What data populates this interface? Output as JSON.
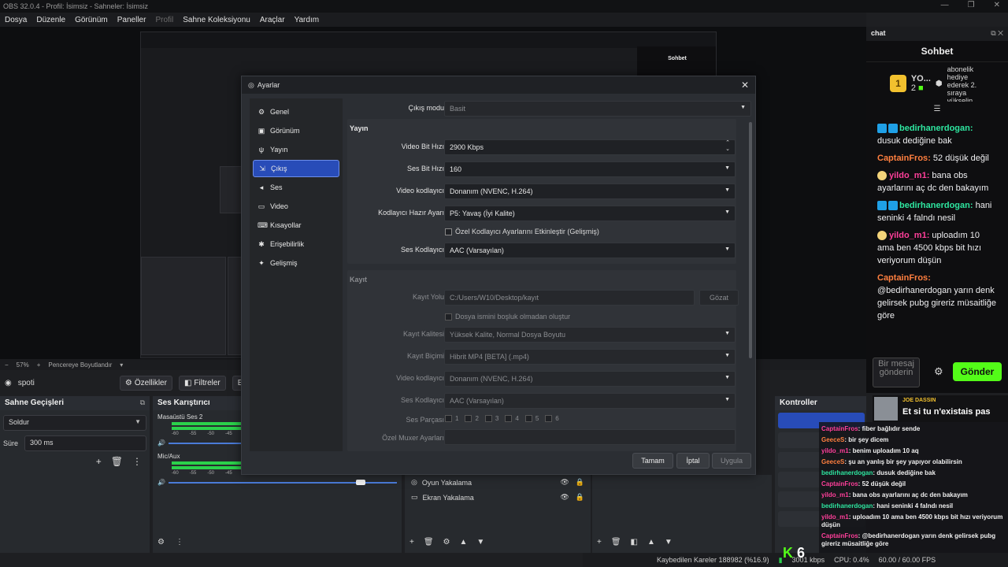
{
  "window": {
    "title": "OBS 32.0.4 - Profil: İsimsiz - Sahneler: İsimsiz"
  },
  "menu": [
    "Dosya",
    "Düzenle",
    "Görünüm",
    "Paneller",
    "Profil",
    "Sahne Koleksiyonu",
    "Araçlar",
    "Yardım"
  ],
  "preview": {
    "zoom": "57%",
    "fit_label": "Pencereye Boyutlandır",
    "mini_chat_title": "Sohbet"
  },
  "source_bar": {
    "source": "spoti",
    "properties": "Özellikler",
    "filters": "Filtreler",
    "more": "Et"
  },
  "scene_transitions": {
    "title": "Sahne Geçişleri",
    "transition": "Soldur",
    "duration_label": "Süre",
    "duration": "300 ms"
  },
  "mixer": {
    "title": "Ses Karıştırıcı",
    "channels": [
      {
        "name": "Masaüstü Ses 2",
        "ticks": [
          "-60",
          "-55",
          "-50",
          "-45"
        ]
      },
      {
        "name": "Mic/Aux",
        "ticks": [
          "-60",
          "-55",
          "-50",
          "-45"
        ]
      }
    ]
  },
  "sources": [
    {
      "name": "Oyun Yakalama"
    },
    {
      "name": "Ekran Yakalama"
    }
  ],
  "controls": {
    "title": "Kontroller"
  },
  "chat": {
    "dock_title": "chat",
    "title": "Sohbet",
    "pinned_user": "YO...",
    "pinned_rank": "1",
    "pinned_count": "2",
    "gift_text": "abonelik hediye ederek 2. sıraya yükselin",
    "messages": [
      {
        "user": "bedirhanerdogan",
        "text": "dusuk dediğine bak",
        "color": "green"
      },
      {
        "user": "CaptainFros",
        "text": "52 düşük değil",
        "color": "orange"
      },
      {
        "user": "yildo_m1",
        "text": "bana obs ayarlarını aç dc den bakayım",
        "color": "pink"
      },
      {
        "user": "bedirhanerdogan",
        "text": "hani seninki 4 falndı nesil",
        "color": "green"
      },
      {
        "user": "yildo_m1",
        "text": "uploadım 10 ama ben 4500 kbps bit hızı veriyorum düşün",
        "color": "pink"
      },
      {
        "user": "CaptainFros",
        "text": "@bedirhanerdogan yarın denk gelirsek pubg gireriz müsaitliğe göre",
        "color": "orange"
      }
    ],
    "input_placeholder": "Bir mesaj gönderin",
    "send": "Gönder"
  },
  "music": {
    "artist": "JOE DASSIN",
    "song": "Et si tu n'existais pas"
  },
  "overlay_chat": [
    {
      "user": "CaptainFros",
      "text": "fiber bağlıdır sende"
    },
    {
      "user": "GeeceS",
      "text": "bir şey dicem"
    },
    {
      "user": "yildo_m1",
      "text": "benim uploadım 10 aq"
    },
    {
      "user": "GeeceS",
      "text": "şu an yanlış bir şey yapıyor olabilirsin"
    },
    {
      "user": "bedirhanerdogan",
      "text": "dusuk dediğine bak"
    },
    {
      "user": "CaptainFros",
      "text": "52 düşük değil"
    },
    {
      "user": "yildo_m1",
      "text": "bana obs ayarlarını aç dc den bakayım"
    },
    {
      "user": "bedirhanerdogan",
      "text": "hani seninki 4 falndı nesil"
    },
    {
      "user": "yildo_m1",
      "text": "uploadım 10 ama ben 4500 kbps bit hızı veriyorum düşün"
    },
    {
      "user": "CaptainFros",
      "text": "@bedirhanerdogan yarın denk gelirsek pubg gireriz müsaitliğe göre"
    }
  ],
  "status": {
    "dropped": "Kaybedilen Kareler 188982 (%16.9)",
    "bitrate": "3001 kbps",
    "cpu": "CPU: 0.4%",
    "fps": "60.00 / 60.00 FPS",
    "kick_count": "6"
  },
  "settings": {
    "title": "Ayarlar",
    "sidebar": [
      "Genel",
      "Görünüm",
      "Yayın",
      "Çıkış",
      "Ses",
      "Video",
      "Kısayollar",
      "Erişebilirlik",
      "Gelişmiş"
    ],
    "active_index": 3,
    "output_mode_label": "Çıkış modu",
    "output_mode": "Basit",
    "stream_group": "Yayın",
    "stream": {
      "video_bitrate_label": "Video Bit Hızı",
      "video_bitrate": "2900 Kbps",
      "audio_bitrate_label": "Ses Bit Hızı",
      "audio_bitrate": "160",
      "encoder_label": "Video kodlayıcı",
      "encoder": "Donanım (NVENC, H.264)",
      "preset_label": "Kodlayıcı Hazır Ayarı",
      "preset": "P5: Yavaş (İyi Kalite)",
      "custom_label": "Özel Kodlayıcı Ayarlarını Etkinleştir (Gelişmiş)",
      "audio_encoder_label": "Ses Kodlayıcı",
      "audio_encoder": "AAC (Varsayılan)"
    },
    "record_group": "Kayıt",
    "record": {
      "path_label": "Kayıt Yolu",
      "path": "C:/Users/W10/Desktop/kayıt",
      "browse": "Gözat",
      "nospace_label": "Dosya ismini boşluk olmadan oluştur",
      "quality_label": "Kayıt Kalitesi",
      "quality": "Yüksek Kalite, Normal Dosya Boyutu",
      "format_label": "Kayıt Biçimi",
      "format": "Hibrit MP4 [BETA] (.mp4)",
      "encoder_label": "Video kodlayıcı",
      "encoder": "Donanım (NVENC, H.264)",
      "audio_encoder_label": "Ses Kodlayıcı",
      "audio_encoder": "AAC (Varsayılan)",
      "tracks_label": "Ses Parçası",
      "tracks": [
        "1",
        "2",
        "3",
        "4",
        "5",
        "6"
      ],
      "muxer_label": "Özel Muxer Ayarları"
    },
    "buttons": {
      "ok": "Tamam",
      "cancel": "İptal",
      "apply": "Uygula"
    }
  }
}
